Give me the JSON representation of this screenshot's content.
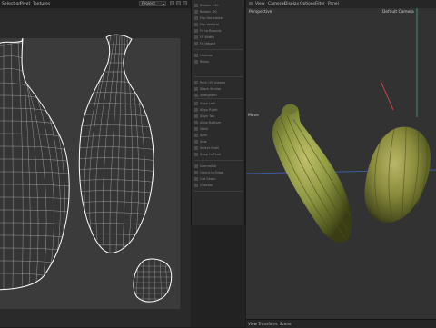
{
  "uv_editor": {
    "toolbar": {
      "items": [
        "Selection",
        "Pivot",
        "Textures"
      ],
      "dropdown_value": "Project"
    }
  },
  "tool_menu": {
    "items": [
      "Rotate +90",
      "Rotate -90",
      "Flip Horizontal",
      "Flip Vertical",
      "Fit to Bounds",
      "Fit Width",
      "Fit Height",
      "Unwrap",
      "Relax",
      "Pack UV Islands",
      "Stack Similar",
      "Straighten",
      "Align Left",
      "Align Right",
      "Align Top",
      "Align Bottom",
      "Weld",
      "Split",
      "Sew",
      "Select Shell",
      "Snap to Pixel",
      "Normalize",
      "Orient to Edge",
      "Cut Seam",
      "Checker"
    ]
  },
  "viewport": {
    "menu": [
      "View",
      "Cameras",
      "Display",
      "Options",
      "Filter",
      "Panel"
    ],
    "view_name": "Perspective",
    "camera": "Default Camera",
    "mode_label": "Move",
    "footer": "View Transform: Scene"
  },
  "colors": {
    "panel_bg": "#2a2a2a",
    "uv_space": "#3b3b3b",
    "wire": "#ffffff",
    "viewport_bg": "#323232",
    "pod_green": "#8f9842",
    "axis_x": "#c84444",
    "axis_y": "#3f9a7f",
    "axis_z": "#3c64b4"
  }
}
